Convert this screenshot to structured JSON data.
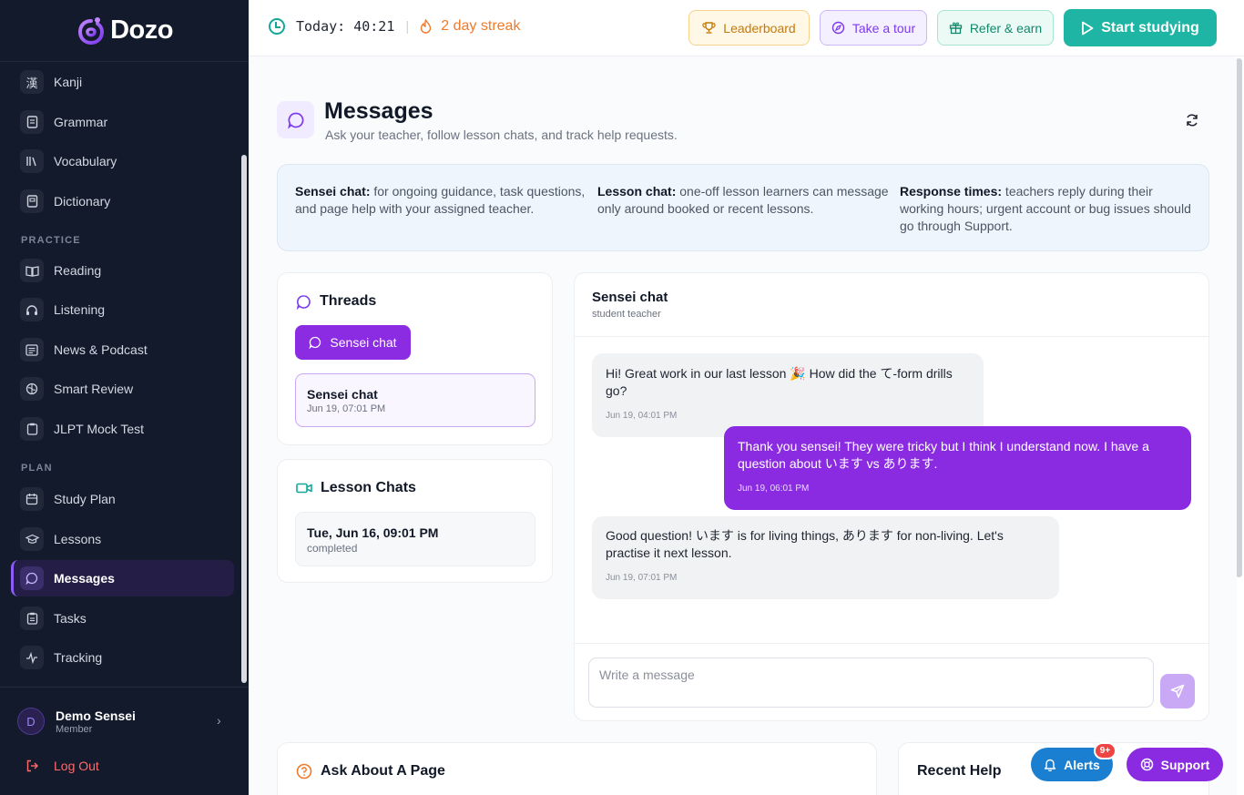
{
  "app": {
    "name": "Dozo",
    "brand_color": "#8b5cf6"
  },
  "sidebar": {
    "items_top": [
      {
        "label": "Kanji",
        "icon": "kanji-icon",
        "glyph": "漢"
      },
      {
        "label": "Grammar",
        "icon": "document-icon"
      },
      {
        "label": "Vocabulary",
        "icon": "library-icon"
      },
      {
        "label": "Dictionary",
        "icon": "book-icon"
      }
    ],
    "practice_label": "PRACTICE",
    "items_practice": [
      {
        "label": "Reading",
        "icon": "open-book-icon"
      },
      {
        "label": "Listening",
        "icon": "headphones-icon"
      },
      {
        "label": "News & Podcast",
        "icon": "newspaper-icon"
      },
      {
        "label": "Smart Review",
        "icon": "brain-icon"
      },
      {
        "label": "JLPT Mock Test",
        "icon": "clipboard-icon"
      }
    ],
    "plan_label": "PLAN",
    "items_plan": [
      {
        "label": "Study Plan",
        "icon": "calendar-icon"
      },
      {
        "label": "Lessons",
        "icon": "graduation-cap-icon"
      },
      {
        "label": "Messages",
        "icon": "message-icon",
        "active": true
      },
      {
        "label": "Tasks",
        "icon": "clipboard-check-icon"
      },
      {
        "label": "Tracking",
        "icon": "activity-icon"
      }
    ],
    "user": {
      "initial": "D",
      "name": "Demo Sensei",
      "role": "Member"
    },
    "logout_label": "Log Out"
  },
  "topbar": {
    "today_label": "Today:",
    "today_time": "40:21",
    "streak": "2 day streak",
    "leaderboard": "Leaderboard",
    "tour": "Take a tour",
    "refer": "Refer & earn",
    "start": "Start studying"
  },
  "page": {
    "title": "Messages",
    "subtitle": "Ask your teacher, follow lesson chats, and track help requests."
  },
  "info": [
    {
      "term": "Sensei chat:",
      "text": " for ongoing guidance, task questions, and page help with your assigned teacher."
    },
    {
      "term": "Lesson chat:",
      "text": " one-off lesson learners can message only around booked or recent lessons."
    },
    {
      "term": "Response times:",
      "text": " teachers reply during their working hours; urgent account or bug issues should go through Support."
    }
  ],
  "threads": {
    "title": "Threads",
    "active_pill": "Sensei chat",
    "items": [
      {
        "title": "Sensei chat",
        "time": "Jun 19, 07:01 PM"
      }
    ]
  },
  "lesson_chats": {
    "title": "Lesson Chats",
    "items": [
      {
        "title": "Tue, Jun 16, 09:01 PM",
        "status": "completed"
      }
    ]
  },
  "chat": {
    "title": "Sensei chat",
    "subtitle": "student teacher",
    "messages": [
      {
        "from": "teacher",
        "text": "Hi! Great work in our last lesson 🎉 How did the て-form drills go?",
        "time": "Jun 19, 04:01 PM"
      },
      {
        "from": "student",
        "text": "Thank you sensei! They were tricky but I think I understand now. I have a question about います vs あります.",
        "time": "Jun 19, 06:01 PM"
      },
      {
        "from": "teacher",
        "text": "Good question! います is for living things, あります for non-living. Let's practise it next lesson.",
        "time": "Jun 19, 07:01 PM"
      }
    ],
    "compose_placeholder": "Write a message"
  },
  "ask_page": {
    "title": "Ask About A Page"
  },
  "recent_help": {
    "title": "Recent Help"
  },
  "fab": {
    "alerts": "Alerts",
    "alerts_badge": "9+",
    "support": "Support"
  }
}
